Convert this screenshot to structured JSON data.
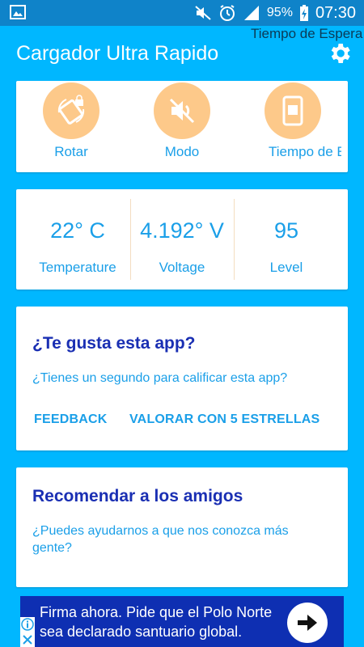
{
  "status_bar": {
    "battery_percent": "95%",
    "time": "07:30"
  },
  "header": {
    "title": "Cargador Ultra Rapido",
    "overflow_title": "Tiempo de Espera"
  },
  "quick_actions": [
    {
      "label": "Rotar",
      "icon": "screen-rotation-lock-icon"
    },
    {
      "label": "Modo",
      "icon": "volume-mute-icon"
    },
    {
      "label": "Tiempo de Espera",
      "icon": "screen-timeout-icon"
    }
  ],
  "stats": [
    {
      "value": "22° C",
      "label": "Temperature"
    },
    {
      "value": "4.192° V",
      "label": "Voltage"
    },
    {
      "value": "95",
      "label": "Level"
    }
  ],
  "rate_card": {
    "title": "¿Te gusta esta app?",
    "subtitle": "¿Tienes un segundo para calificar esta app?",
    "feedback_label": "FEEDBACK",
    "rate_label": "VALORAR CON 5 ESTRELLAS"
  },
  "recommend_card": {
    "title": "Recomendar a los amigos",
    "subtitle": "¿Puedes ayudarnos a que nos conozca más gente?"
  },
  "ad": {
    "text": "Firma ahora. Pide que el Polo Norte sea declarado santuario global."
  },
  "colors": {
    "background": "#00b7ff",
    "status_bar": "#0f83c9",
    "accent": "#1a9fe8",
    "title_blue": "#1a2fb3",
    "circle": "#fdc98a",
    "ad_background": "#0e2fb2"
  }
}
